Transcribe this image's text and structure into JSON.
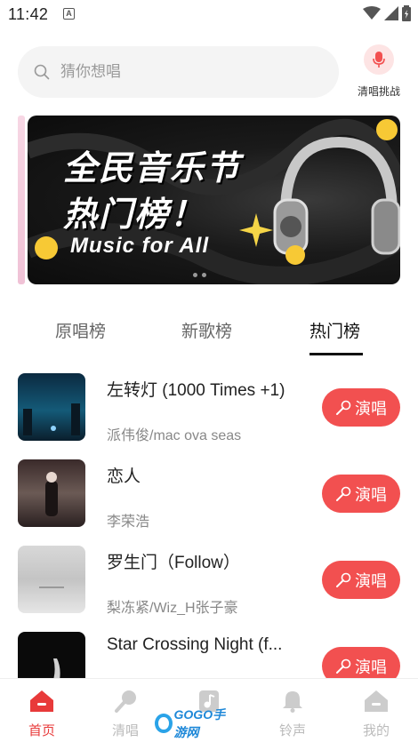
{
  "status_bar": {
    "time": "11:42",
    "notification_icon": "A"
  },
  "search": {
    "placeholder": "猜你想唱"
  },
  "challenge": {
    "label": "清唱挑战"
  },
  "banner": {
    "title_line1": "全民音乐节",
    "title_line2": "热门榜！",
    "subtitle": "Music for All"
  },
  "tabs": [
    {
      "label": "原唱榜"
    },
    {
      "label": "新歌榜"
    },
    {
      "label": "热门榜"
    }
  ],
  "songs": [
    {
      "title": "左转灯 (1000 Times +1)",
      "artist": "派伟俊/mac ova seas",
      "button": "演唱"
    },
    {
      "title": "恋人",
      "artist": "李荣浩",
      "button": "演唱"
    },
    {
      "title": "罗生门（Follow）",
      "artist": "梨冻紧/Wiz_H张子豪",
      "button": "演唱"
    },
    {
      "title": "Star Crossing Night (f...",
      "artist": "",
      "button": "演唱"
    }
  ],
  "bottom_nav": [
    {
      "label": "首页"
    },
    {
      "label": "清唱"
    },
    {
      "label": ""
    },
    {
      "label": "铃声"
    },
    {
      "label": "我的"
    }
  ],
  "watermark": {
    "text": "GOGO手游网"
  },
  "colors": {
    "accent": "#f25050",
    "active_nav": "#e83a3a"
  }
}
